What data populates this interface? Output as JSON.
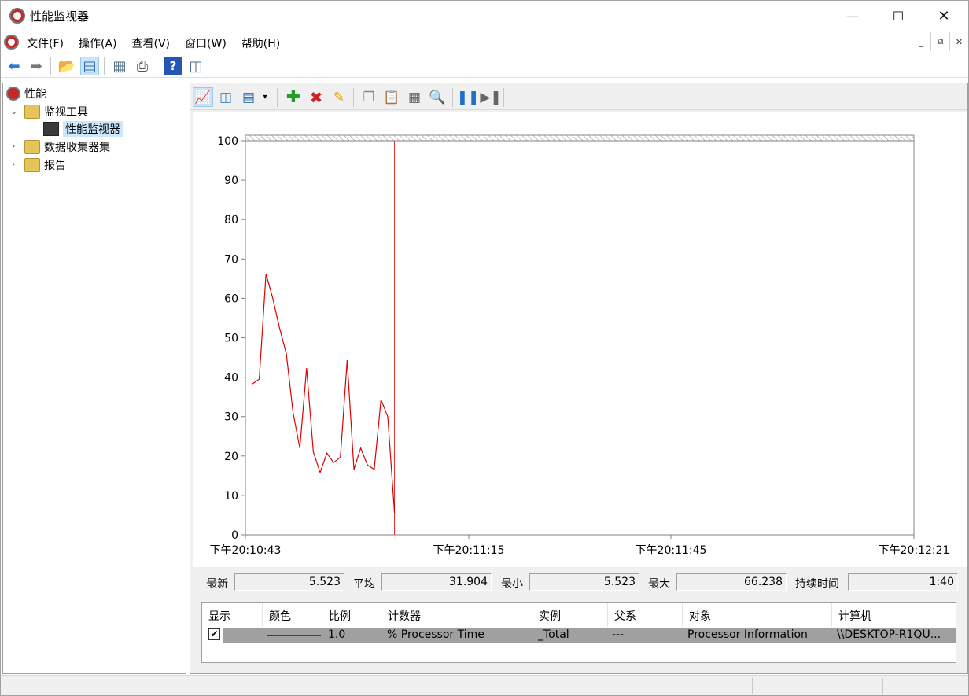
{
  "window": {
    "title": "性能监视器"
  },
  "menu": {
    "items": [
      "文件(F)",
      "操作(A)",
      "查看(V)",
      "窗口(W)",
      "帮助(H)"
    ]
  },
  "tree": {
    "root": "性能",
    "monitoring_tools": "监视工具",
    "perf_monitor": "性能监视器",
    "data_collector_sets": "数据收集器集",
    "reports": "报告"
  },
  "chart_data": {
    "type": "line",
    "ylim": [
      0,
      100
    ],
    "yticks": [
      "0",
      "10",
      "20",
      "30",
      "40",
      "50",
      "60",
      "70",
      "80",
      "90",
      "100"
    ],
    "xtick_labels": [
      "下午20:10:43",
      "下午20:11:15",
      "下午20:11:45",
      "下午20:12:21"
    ],
    "series": [
      {
        "color": "#e00000",
        "values": [
          38.3,
          39.5,
          66.2,
          60.0,
          52.5,
          46.0,
          31.0,
          22.0,
          42.3,
          21.0,
          15.8,
          20.7,
          18.3,
          19.7,
          44.3,
          16.6,
          22.0,
          17.7,
          16.6,
          34.3,
          30.0,
          5.523
        ]
      }
    ]
  },
  "stats": {
    "latest_label": "最新",
    "latest": "5.523",
    "avg_label": "平均",
    "avg": "31.904",
    "min_label": "最小",
    "min": "5.523",
    "max_label": "最大",
    "max": "66.238",
    "duration_label": "持续时间",
    "duration": "1:40"
  },
  "legend": {
    "headers": [
      "显示",
      "颜色",
      "比例",
      "计数器",
      "实例",
      "父系",
      "对象",
      "计算机"
    ],
    "row": {
      "show": "✔",
      "scale": "1.0",
      "counter": "% Processor Time",
      "instance": "_Total",
      "parent": "---",
      "object": "Processor Information",
      "computer": "\\\\DESKTOP-R1QU..."
    }
  }
}
